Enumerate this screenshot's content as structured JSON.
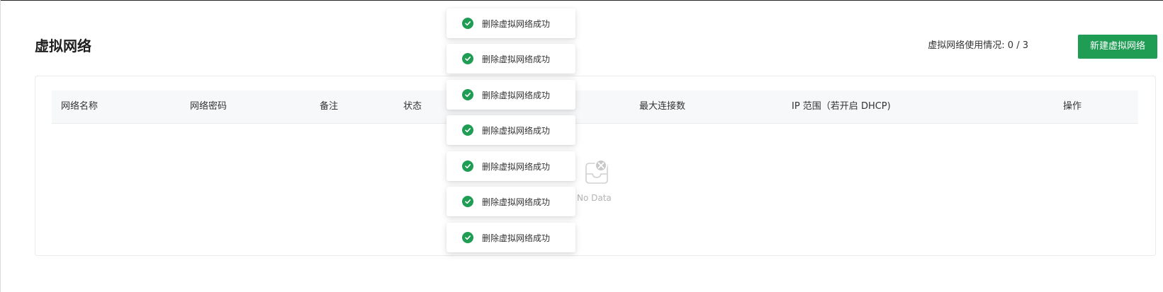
{
  "header": {
    "title": "虚拟网络",
    "usage_text": "虚拟网络使用情况: 0 / 3",
    "new_button_label": "新建虚拟网络"
  },
  "table": {
    "columns": [
      "网络名称",
      "网络密码",
      "备注",
      "状态",
      "最大连接数",
      "IP 范围（若开启 DHCP)",
      "操作"
    ],
    "empty_text": "No Data"
  },
  "toasts": [
    {
      "message": "删除虚拟网络成功",
      "type": "success"
    },
    {
      "message": "删除虚拟网络成功",
      "type": "success"
    },
    {
      "message": "删除虚拟网络成功",
      "type": "success"
    },
    {
      "message": "删除虚拟网络成功",
      "type": "success"
    },
    {
      "message": "删除虚拟网络成功",
      "type": "success"
    },
    {
      "message": "删除虚拟网络成功",
      "type": "success"
    },
    {
      "message": "删除虚拟网络成功",
      "type": "success"
    }
  ],
  "icons": {
    "toast": "check-circle-icon",
    "empty": "empty-inbox-icon"
  },
  "colors": {
    "primary": "#1f9d55",
    "border": "#ebebeb",
    "header_bg": "#f7f8fa",
    "empty_text": "#b3b3b3"
  }
}
